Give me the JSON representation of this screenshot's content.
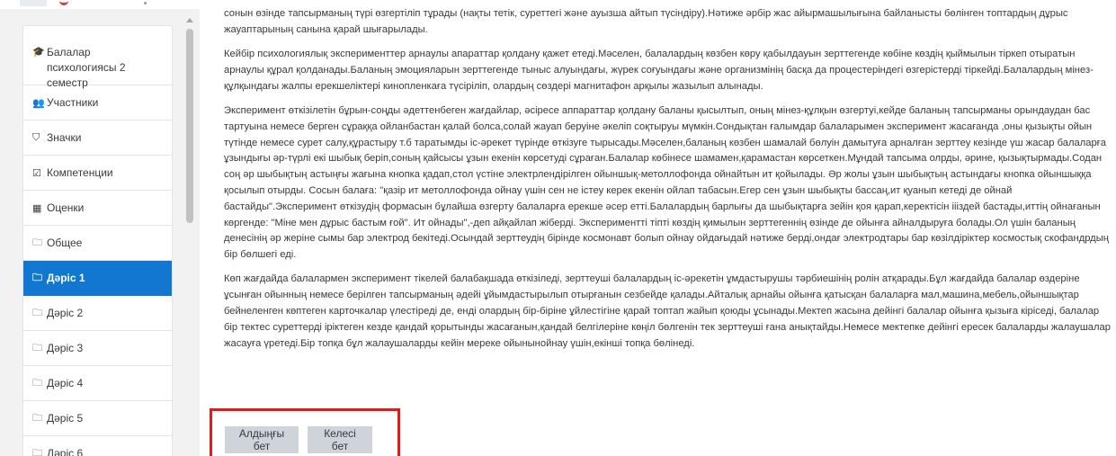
{
  "sidebar": {
    "items": [
      {
        "label": "Балалар психологиясы 2 семестр",
        "icon": "graduation-cap-icon",
        "glyph": "🎓"
      },
      {
        "label": "Участники",
        "icon": "users-icon",
        "glyph": "👥"
      },
      {
        "label": "Значки",
        "icon": "shield-icon",
        "glyph": "⛉"
      },
      {
        "label": "Компетенции",
        "icon": "checkbox-icon",
        "glyph": "☑"
      },
      {
        "label": "Оценки",
        "icon": "table-icon",
        "glyph": "▦"
      },
      {
        "label": "Общее",
        "icon": "folder-icon",
        "glyph": "🗀"
      },
      {
        "label": "Дәріс 1",
        "icon": "folder-icon",
        "glyph": "🗀"
      },
      {
        "label": "Дәріс 2",
        "icon": "folder-icon",
        "glyph": "🗀"
      },
      {
        "label": "Дәріс 3",
        "icon": "folder-icon",
        "glyph": "🗀"
      },
      {
        "label": "Дәріс 4",
        "icon": "folder-icon",
        "glyph": "🗀"
      },
      {
        "label": "Дәріс 5",
        "icon": "folder-icon",
        "glyph": "🗀"
      },
      {
        "label": "Дәріс 6",
        "icon": "folder-icon",
        "glyph": "🗀"
      }
    ],
    "active_index": 6
  },
  "content": {
    "paragraphs": [
      "сонын өзінде тапсырманың түрі өзгертіліп тұрады (нақты тетік, суреттегі және ауызша айтып түсіндіру).Нәтиже әрбір жас айырмашылығына байланысты бөлінген топтардың дұрыс жауаптарының санына қарай шығарылады.",
      "Кейбір психологиялық эксперименттер арнаулы апараттар қолдану қажет етеді.Мәселен, балалардың көзбен көру қабылдауын зерттегенде көбіне көздің қыймылын тіркеп отыратын арнаулы құрал қолданады.Баланың эмоцияларын зерттегенде тыныс алуындағы, жүрек соғуындағы және организмінің басқа да процестеріндегі өзгерістерді тіркейді.Балалардың мінез-құлқындағы жалпы ерекшеліктері кинопленкаға түсіріліп, олардың сөздері магнитафон арқылы жазылып алынады.",
      "Эксперимент өткізілетін бұрын-соңды әдеттенбеген жағдайлар, әсіресе аппараттар қолдану баланы қысылтып, оның мінез-құлқын өзгертуі,кейде баланың тапсырманы орындаудан бас тартуына немесе берген сұраққа ойланбастан қалай болса,солай жауап беруіне әкеліп соқтыруы мүмкін.Сондықтан ғалымдар балаларымен эксперимент жасағанда ,оны қызықты ойын түтінде немесе сурет салу,құрастыру т.б таратымды іс-әрекет түрінде өткізуге тырысады.Мәселен,баланың көзбен шамалай бөлуін дамытуға арналған зерттеу кезінде үш жасар балаларға ұзындығы әр-түрлі екі шыбық беріп,соның қайсысы ұзын екенін көрсетуді сұраған.Балалар көбінесе шамамен,қарамастан көрсеткен.Мұндай тапсыма олрды, әрине, қызықтырмады.Содан соң әр шыбықтың астыңғы жағына кнопка қадап,стол үстіне электрлендірілген ойыншық-метоллофонда ойнайтын ит қойылады. Әр жолы ұзын шыбықтың астындағы кнопка ойыншыққа қосылып отырды. Сосын балаға: \"қазір ит метоллофонда ойнау үшін сен не істеу керек екенін ойлап табасын.Егер сен ұзын шыбықты бассаң,ит қуанып кетеді де ойнай бастайды\".Эксперимент өткізудің формасын бұлайша өзгерту балаларға ерекше әсер етті.Балалардың барлығы да шыбықтарға зейін қоя қарап,керектісін іііздей бастады,иттің ойнағанын көргенде: \"Міне мен дұрыс бастым ғой\". Ит ойнады\",-деп айқайлап жіберді. Экспериментті тіпті көздің қимылын зерттегеннің өзінде де ойынға айналдыруға болады.Ол үшін баланың денесінің әр жеріне сымы бар электрод бекітеді.Осындай зерттеудің бірінде космонавт болып ойнау ойдағыдай нәтиже берді,ондағ электродтары бар көзілдіріктер космостық скофандрдың бір бөлшегі еді.",
      "Көп жағдайда балалармен эксперимент тікелей балабақшада өткізіледі, зерттеуші балалардың іс-әрекетін ұмдастырушы тәрбиешінің ролін атқарады.Бұл жағдайда балалар өздеріне ұсынған ойынның немесе берілген тапсырманың әдейі ұйымдастырылып отырғанын сезбейде қалады.Айталық арнайы ойынға қатысқан балаларға мал,машина,мебель,ойыншықтар бейнеленген көптеген карточкалар үлестіреді де, енді олардың бір-біріне ұйлестігіне қарай топтап жайып қоюды ұсынады.Мектеп жасына дейінгі балалар ойынға қызыға кіріседі, балалар бір тектес суреттерді іріктеген кезде қандай қорытынды жасағанын,қандай белгілеріне көңіл бөлгенін тек зерттеуші ғана анықтайды.Немесе мектепке дейінгі ересек балаларды жалаушалар жасауға үретеді.Бір топқа бұл жалаушаларды кейін мереке ойынынойнау үшін,екінші топқа бөлінеді."
    ]
  },
  "navigation": {
    "prev_label": "Алдыңғы бет",
    "next_label": "Келесі бет"
  },
  "colors": {
    "active": "#1177d1",
    "highlight_box": "#e01c1c",
    "button": "#ced4da"
  }
}
